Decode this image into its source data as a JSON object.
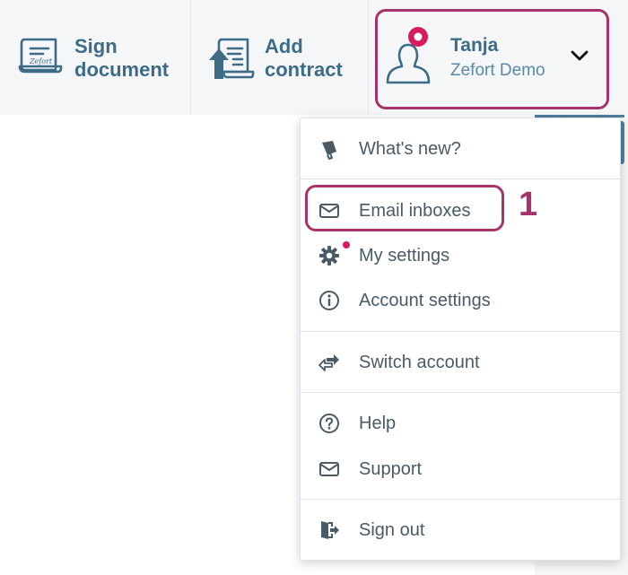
{
  "header": {
    "sign_document": {
      "line1": "Sign",
      "line2": "document",
      "icon": "sign-document-icon"
    },
    "add_contract": {
      "line1": "Add",
      "line2": "contract",
      "icon": "add-contract-icon"
    },
    "user": {
      "name": "Tanja",
      "organization": "Zefort Demo",
      "icon": "user-avatar-icon",
      "menu_icon": "chevron-down-icon"
    }
  },
  "menu": {
    "items": [
      {
        "label": "What's new?",
        "icon": "megaphone-icon"
      },
      {
        "label": "Email inboxes",
        "icon": "envelope-icon"
      },
      {
        "label": "My settings",
        "icon": "gear-icon"
      },
      {
        "label": "Account settings",
        "icon": "info-icon"
      },
      {
        "label": "Switch account",
        "icon": "switch-arrows-icon"
      },
      {
        "label": "Help",
        "icon": "question-icon"
      },
      {
        "label": "Support",
        "icon": "envelope-icon"
      },
      {
        "label": "Sign out",
        "icon": "sign-out-icon"
      }
    ]
  },
  "annotation": {
    "step": "1"
  },
  "colors": {
    "brand": "#3e6b85",
    "accent": "#a8326a",
    "notification": "#d81b60",
    "menu_text": "#4a5a66"
  }
}
